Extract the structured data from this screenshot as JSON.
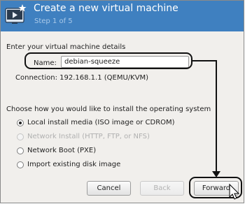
{
  "window": {
    "title": "Create a new virtual machine",
    "subtitle": "Step 1 of 5"
  },
  "details": {
    "section_label": "Enter your virtual machine details",
    "name_label": "Name:",
    "name_value": "debian-squeeze",
    "connection": "Connection: 192.168.1.1 (QEMU/KVM)"
  },
  "install": {
    "label": "Choose how you would like to install the operating system",
    "options": [
      {
        "label": "Local install media (ISO image or CDROM)",
        "selected": true,
        "enabled": true
      },
      {
        "label": "Network Install (HTTP, FTP, or NFS)",
        "selected": false,
        "enabled": false
      },
      {
        "label": "Network Boot (PXE)",
        "selected": false,
        "enabled": true
      },
      {
        "label": "Import existing disk image",
        "selected": false,
        "enabled": true
      }
    ]
  },
  "buttons": {
    "cancel": "Cancel",
    "back": "Back",
    "forward": "Forward"
  },
  "icons": {
    "app": "virtual-machine-wizard-icon",
    "pointer": "mouse-pointer-icon"
  },
  "colors": {
    "banner": "#3f80c0",
    "banner_text": "#ffffff",
    "subtitle_text": "#a9c9e9",
    "dialog_background": "#f1efec",
    "annotation": "#111111"
  }
}
